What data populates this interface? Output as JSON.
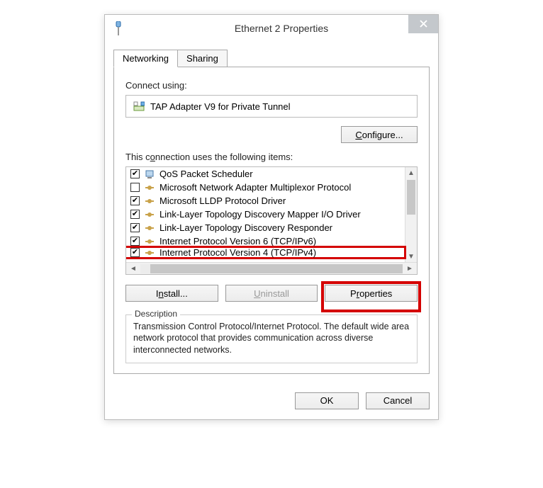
{
  "window": {
    "title": "Ethernet 2 Properties"
  },
  "tabs": {
    "networking": "Networking",
    "sharing": "Sharing"
  },
  "panel": {
    "connect_label": "Connect using:",
    "adapter_name": "TAP Adapter V9 for Private Tunnel",
    "configure_btn": "Configure...",
    "items_label": "This connection uses the following items:",
    "items": [
      {
        "checked": true,
        "label": "QoS Packet Scheduler",
        "icon": "net"
      },
      {
        "checked": false,
        "label": "Microsoft Network Adapter Multiplexor Protocol",
        "icon": "proto"
      },
      {
        "checked": true,
        "label": "Microsoft LLDP Protocol Driver",
        "icon": "proto"
      },
      {
        "checked": true,
        "label": "Link-Layer Topology Discovery Mapper I/O Driver",
        "icon": "proto"
      },
      {
        "checked": true,
        "label": "Link-Layer Topology Discovery Responder",
        "icon": "proto"
      },
      {
        "checked": true,
        "label": "Internet Protocol Version 6 (TCP/IPv6)",
        "icon": "proto"
      },
      {
        "checked": true,
        "label": "Internet Protocol Version 4 (TCP/IPv4)",
        "icon": "proto",
        "highlighted": true
      }
    ],
    "install_btn": "Install...",
    "uninstall_btn": "Uninstall",
    "properties_btn": "Properties",
    "desc_legend": "Description",
    "desc_text": "Transmission Control Protocol/Internet Protocol. The default wide area network protocol that provides communication across diverse interconnected networks."
  },
  "bottom": {
    "ok": "OK",
    "cancel": "Cancel"
  }
}
